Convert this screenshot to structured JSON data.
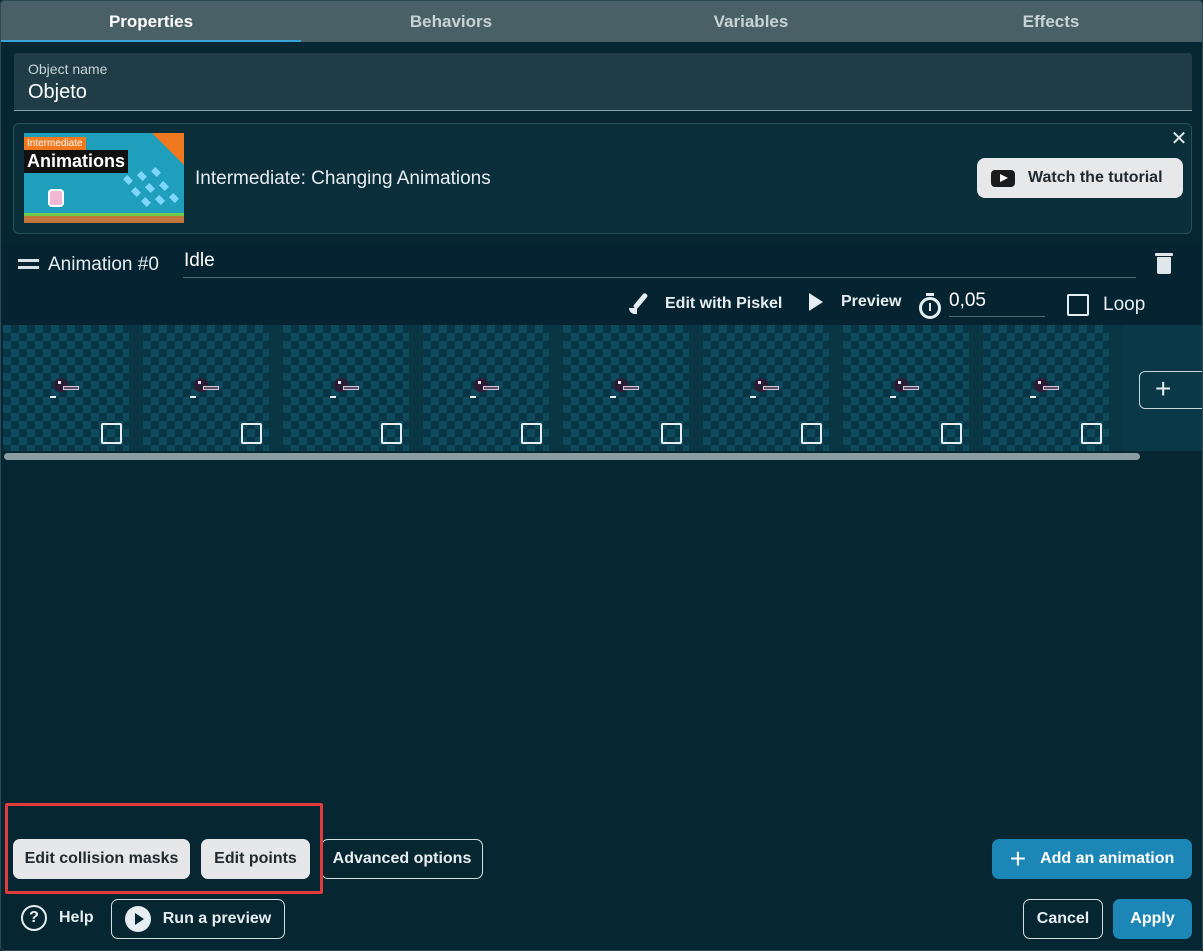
{
  "tabs": [
    {
      "label": "Properties",
      "active": true
    },
    {
      "label": "Behaviors",
      "active": false
    },
    {
      "label": "Variables",
      "active": false
    },
    {
      "label": "Effects",
      "active": false
    }
  ],
  "object_name": {
    "label": "Object name",
    "value": "Objeto"
  },
  "tutorial": {
    "thumbnail_tag": "Intermediate",
    "thumbnail_title": "Animations",
    "title": "Intermediate: Changing Animations",
    "watch_label": "Watch the tutorial",
    "close_icon": "close-icon"
  },
  "animation": {
    "label": "Animation #0",
    "name": "Idle",
    "edit_with_piskel": "Edit with Piskel",
    "preview": "Preview",
    "interval": "0,05",
    "loop_label": "Loop",
    "loop_checked": false,
    "frame_count_visible": 8
  },
  "buttons": {
    "edit_collision_masks": "Edit collision masks",
    "edit_points": "Edit points",
    "advanced_options": "Advanced options",
    "add_animation": "Add an animation",
    "help": "Help",
    "run_preview": "Run a preview",
    "cancel": "Cancel",
    "apply": "Apply"
  },
  "colors": {
    "background": "#062632",
    "tab_bar": "#496066",
    "accent": "#37a3d6",
    "primary_button": "#1c87b6",
    "highlight_border": "#e23b3b"
  }
}
